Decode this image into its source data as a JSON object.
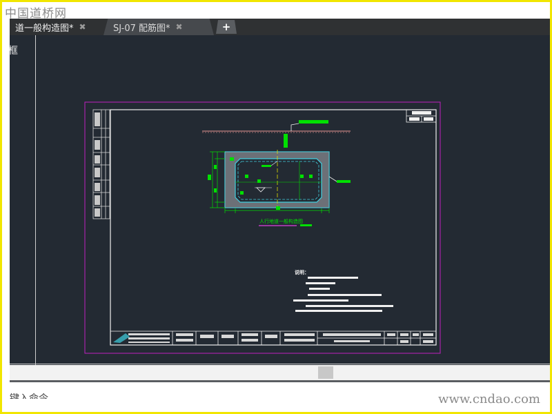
{
  "watermark": {
    "top": "中国道桥网",
    "bottom": "www.cndao.com"
  },
  "tabs": [
    {
      "label": "道一般构造图*",
      "close": "✖",
      "active": true
    },
    {
      "label": "SJ-07 配筋图*",
      "close": "✖",
      "active": false
    }
  ],
  "tab_add_label": "+",
  "canvas": {
    "frame_label": "框",
    "drawing_caption": "人行地道一般构造图",
    "notes_heading": "说明："
  },
  "command_line": {
    "label": "键入命令"
  },
  "colors": {
    "canvas_bg": "#232a33",
    "sheet_border": "#c020c0",
    "line_white": "#f0f0f0",
    "accent_green": "#00e000",
    "structure_cyan": "#40d0e0",
    "caption_magenta": "#e040e0",
    "guide_yellow": "#e0e000",
    "watermark_gray": "#8a8a8a",
    "screenshot_border": "#f1e600"
  }
}
